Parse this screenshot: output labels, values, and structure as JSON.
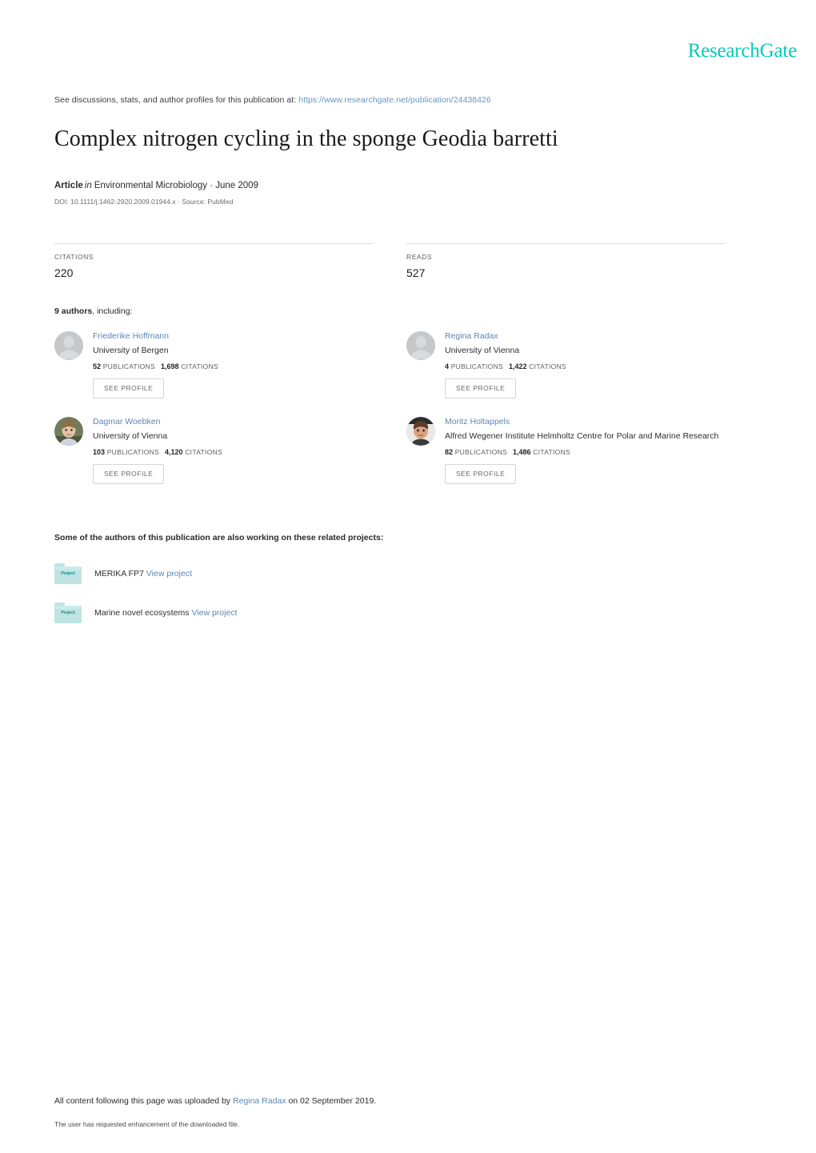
{
  "brand": {
    "name": "ResearchGate",
    "color": "#00ccbb"
  },
  "header": {
    "discussion_prefix": "See discussions, stats, and author profiles for this publication at:",
    "publication_url": "https://www.researchgate.net/publication/24438426",
    "title": "Complex nitrogen cycling in the sponge Geodia barretti",
    "article_label": "Article",
    "article_in": "in",
    "journal_line": "Environmental Microbiology · June 2009",
    "doi_line": "DOI: 10.1111/j.1462-2920.2009.01944.x · Source: PubMed"
  },
  "stats": [
    {
      "label": "CITATIONS",
      "value": "220"
    },
    {
      "label": "READS",
      "value": "527"
    }
  ],
  "authors_section": {
    "count_label": "9 authors",
    "count_suffix": ", including:",
    "see_profile_label": "SEE PROFILE",
    "publications_label": "PUBLICATIONS",
    "citations_label": "CITATIONS",
    "authors": [
      {
        "name": "Friederike Hoffmann",
        "affiliation": "University of Bergen",
        "publications": "52",
        "citations": "1,698",
        "avatar": "placeholder-avatar"
      },
      {
        "name": "Regina Radax",
        "affiliation": "University of Vienna",
        "publications": "4",
        "citations": "1,422",
        "avatar": "placeholder-avatar"
      },
      {
        "name": "Dagmar Woebken",
        "affiliation": "University of Vienna",
        "publications": "103",
        "citations": "4,120",
        "avatar": "photo-avatar-woman"
      },
      {
        "name": "Moritz Holtappels",
        "affiliation": "Alfred Wegener Institute Helmholtz Centre for Polar and Marine Research",
        "publications": "82",
        "citations": "1,486",
        "avatar": "photo-avatar-man"
      }
    ]
  },
  "projects_section": {
    "heading": "Some of the authors of this publication are also working on these related projects:",
    "icon_glyph": "Project",
    "view_label": "View project",
    "projects": [
      {
        "name": "MERIKA FP7"
      },
      {
        "name": "Marine novel ecosystems"
      }
    ]
  },
  "footer": {
    "upload_prefix": "All content following this page was uploaded by",
    "uploader": "Regina Radax",
    "upload_suffix": "on 02 September 2019.",
    "enhancement_note": "The user has requested enhancement of the downloaded file."
  }
}
